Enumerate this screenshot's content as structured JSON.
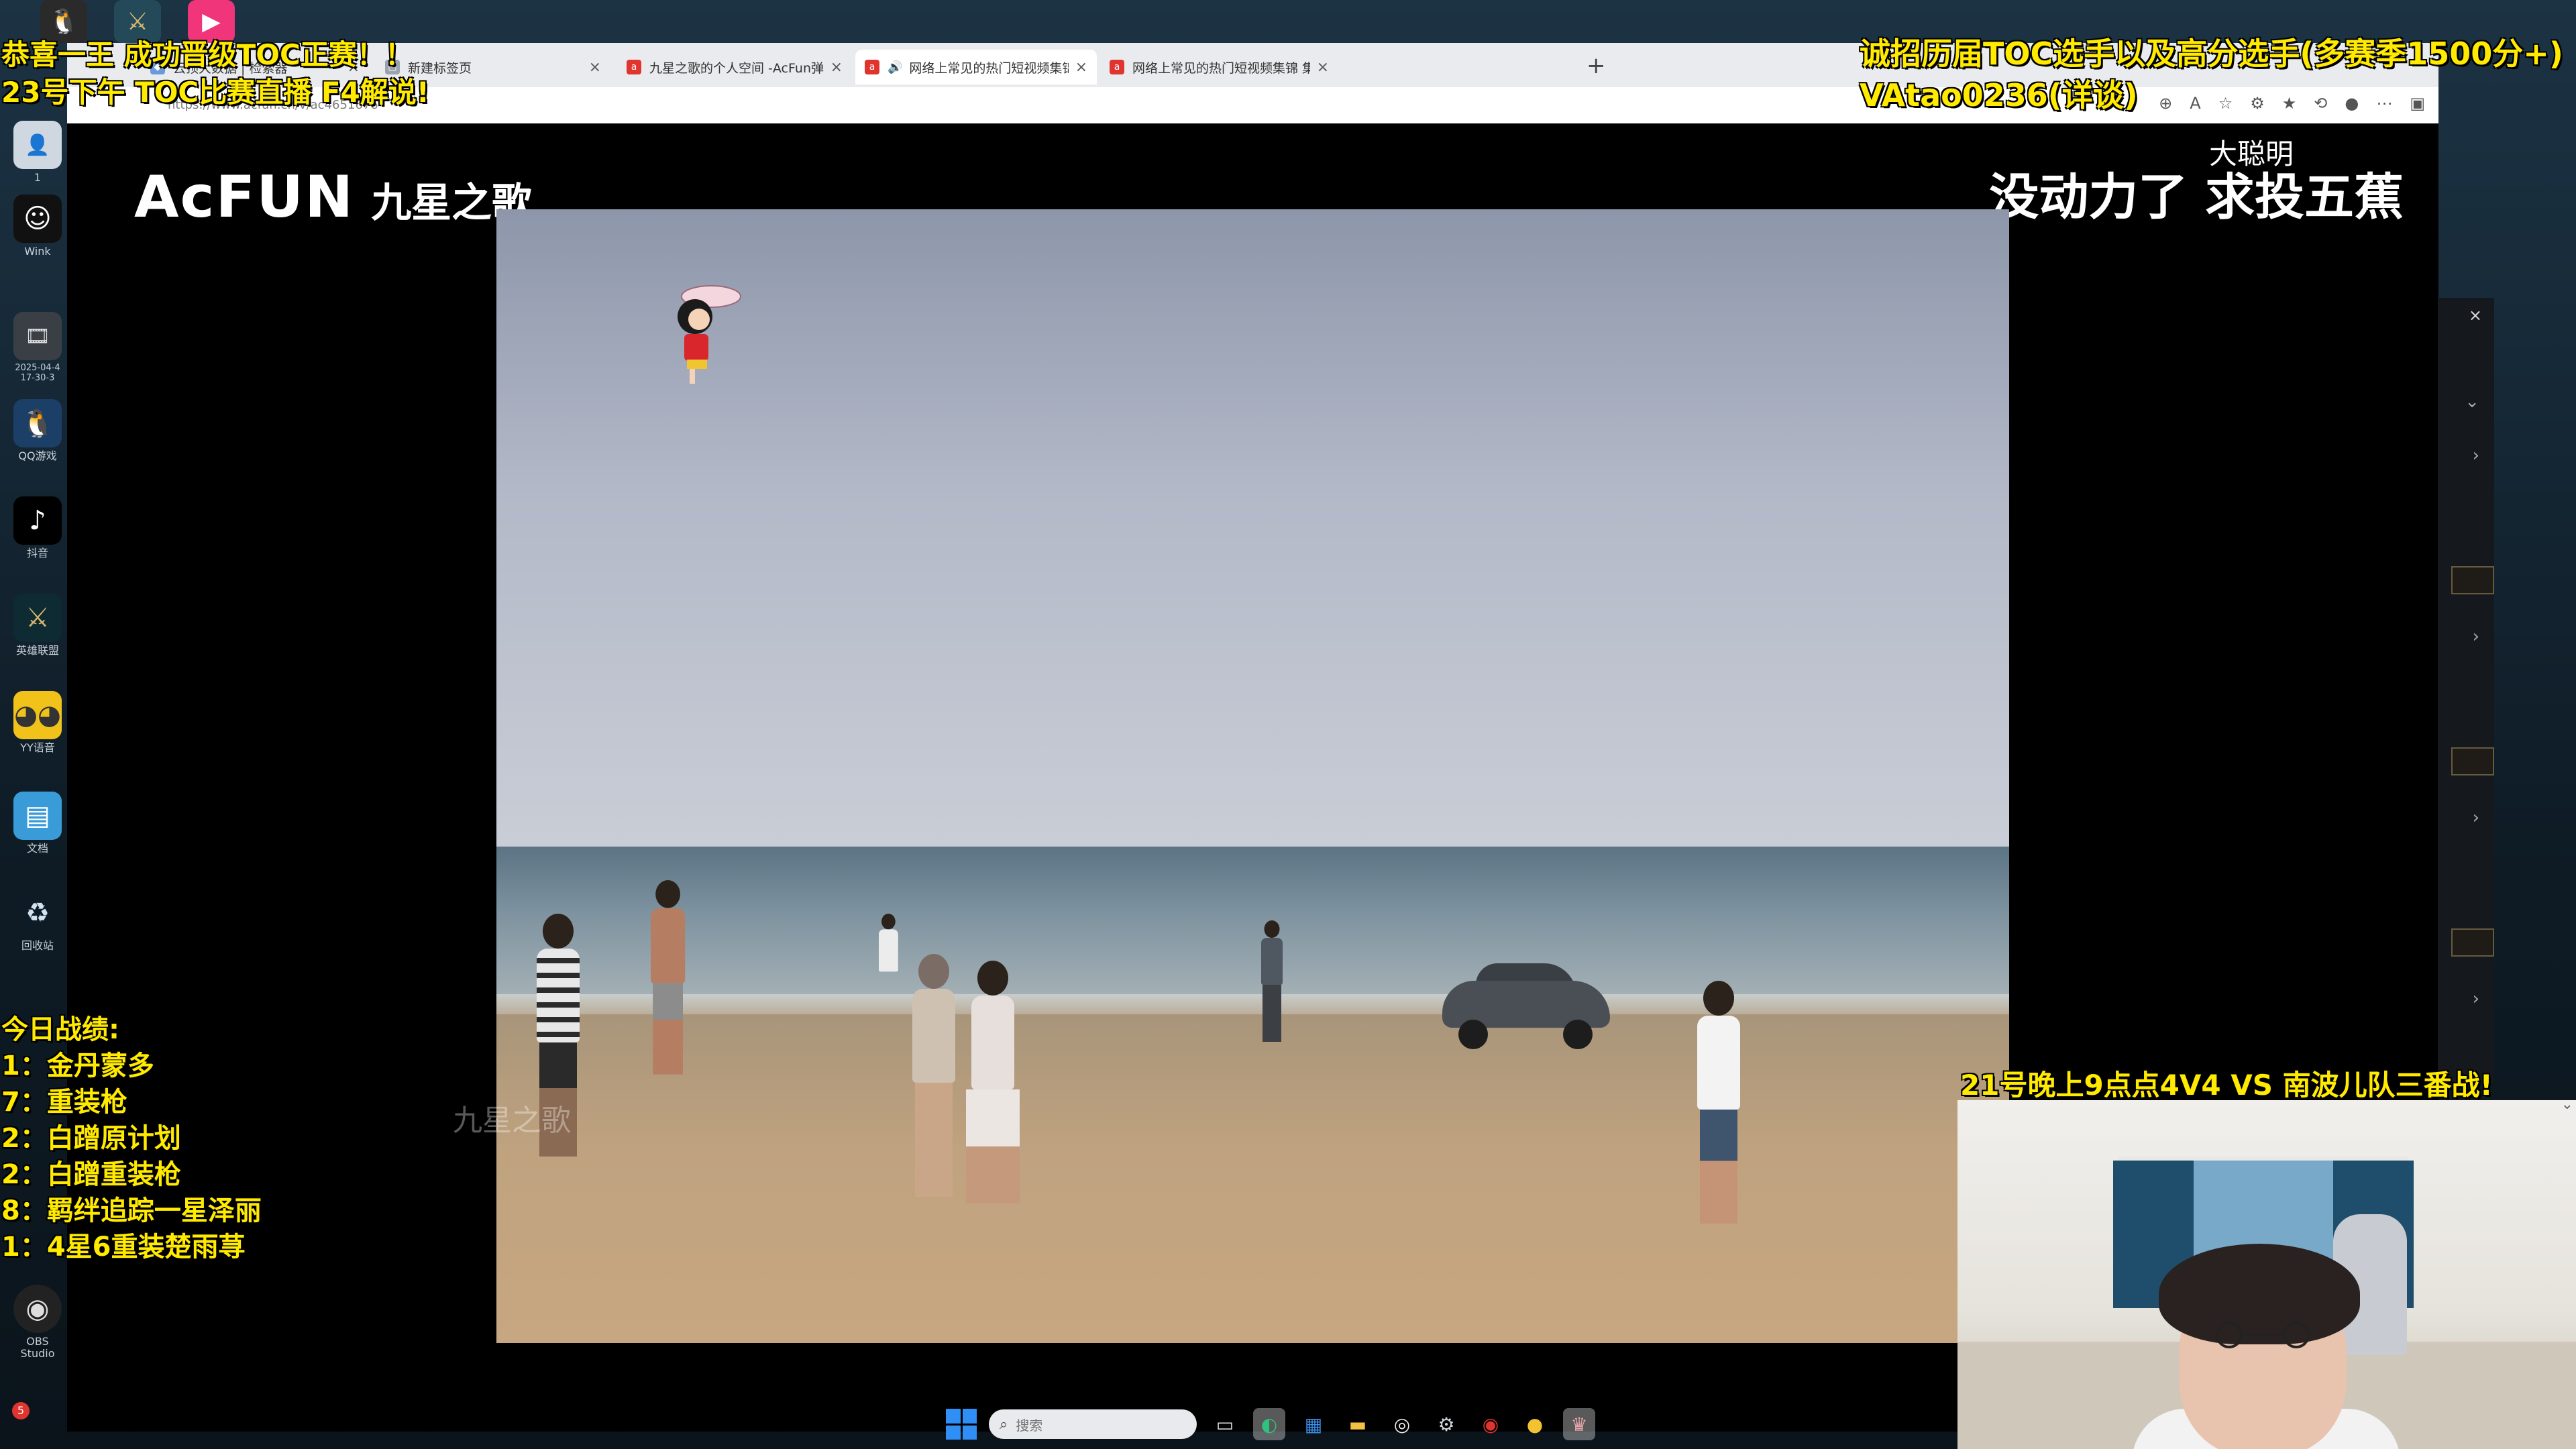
{
  "overlays": {
    "top_left_line1": "恭喜一王 成功晋级TOC正赛！！",
    "top_left_line2": "23号下午 TOC比赛直播 F4解说!",
    "top_right_line1": "诚招历届TOC选手以及高分选手(多赛季1500分+)",
    "top_right_line2": "VAtao0236(详谈)",
    "mid_right": "21号晚上9点点4V4  VS 南波儿队三番战!",
    "record_title": "今日战绩:",
    "records": [
      "1：金丹蒙多",
      "7：重装枪",
      "2：白蹭原计划",
      "2：白蹭重装枪",
      "8：羁绊追踪一星泽丽",
      "1：4星6重装楚雨荨"
    ]
  },
  "browser": {
    "tabs": [
      {
        "title": "云顶大数据 | 检索器",
        "active": false,
        "favicon_color": "#6b9ad8"
      },
      {
        "title": "新建标签页",
        "active": false,
        "favicon_color": "#9aa3ad"
      },
      {
        "title": "九星之歌的个人空间 -AcFun弹幕",
        "active": false,
        "favicon_color": "#e0342f"
      },
      {
        "title": "网络上常见的热门短视频集锦",
        "active": true,
        "favicon_color": "#e0342f"
      },
      {
        "title": "网络上常见的热门短视频集锦 集",
        "active": false,
        "favicon_color": "#e0342f"
      }
    ],
    "new_tab_symbol": "+",
    "url": "https://www.acfun.cn/v/ac4651676"
  },
  "player": {
    "logo_brand": "AcFUN",
    "logo_sub": "九星之歌",
    "caption_small": "大聪明",
    "caption_big": "没动力了 求投五蕉",
    "watermark": "九星之歌"
  },
  "desktop": {
    "icons": [
      {
        "label": "1",
        "icon": "person-icon"
      },
      {
        "label": "Wink",
        "icon": "wink-icon"
      },
      {
        "label": "2025-04-4 17-30-3",
        "icon": "video-file-icon"
      },
      {
        "label": "QQ游戏",
        "icon": "qq-game-icon"
      },
      {
        "label": "抖音",
        "icon": "douyin-icon"
      },
      {
        "label": "英雄联盟",
        "icon": "lol-icon"
      },
      {
        "label": "YY语音",
        "icon": "yy-icon"
      },
      {
        "label": "文档",
        "icon": "document-icon"
      },
      {
        "label": "回收站",
        "icon": "recycle-bin-icon"
      },
      {
        "label": "OBS Studio",
        "icon": "obs-icon"
      }
    ]
  },
  "taskbar": {
    "search_placeholder": "搜索",
    "notification_count": "5",
    "icons": [
      "file-explorer-icon",
      "edge-icon",
      "store-icon",
      "folder-icon",
      "obs-icon",
      "steam-icon",
      "netease-music-icon",
      "chrome-icon",
      "tft-icon"
    ]
  },
  "colors": {
    "overlay_yellow": "#ffea00",
    "accent_red": "#e0342f"
  }
}
